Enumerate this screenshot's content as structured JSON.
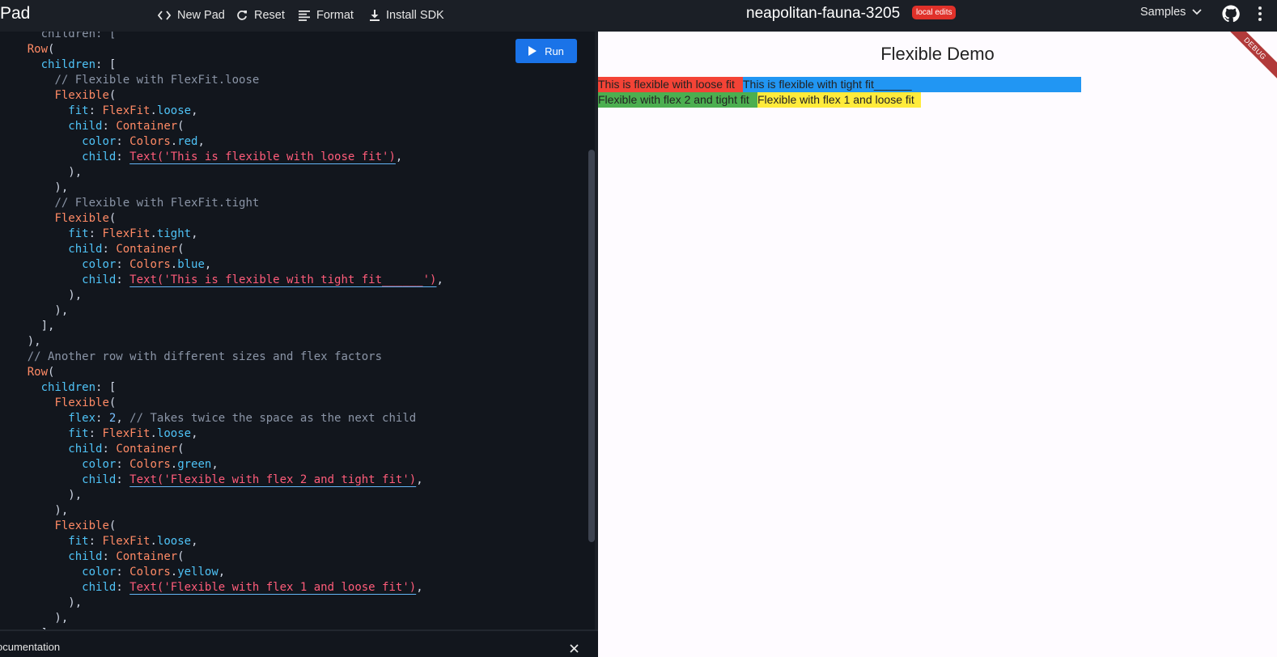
{
  "topbar": {
    "brand": "Pad",
    "new_pad": "New Pad",
    "reset": "Reset",
    "format": "Format",
    "install_sdk": "Install SDK",
    "pad_name": "neapolitan-fauna-3205",
    "badge": "local edits",
    "samples": "Samples"
  },
  "editor": {
    "run_label": "Run",
    "lines": [
      [
        [
          "c",
          "      children: ["
        ]
      ],
      [
        [
          "pu",
          "    "
        ],
        [
          "k",
          "Row"
        ],
        [
          "pu",
          "("
        ]
      ],
      [
        [
          "pu",
          "      "
        ],
        [
          "p",
          "children"
        ],
        [
          "pu",
          ": ["
        ]
      ],
      [
        [
          "pu",
          "        "
        ],
        [
          "c",
          "// Flexible with FlexFit.loose"
        ]
      ],
      [
        [
          "pu",
          "        "
        ],
        [
          "k",
          "Flexible"
        ],
        [
          "pu",
          "("
        ]
      ],
      [
        [
          "pu",
          "          "
        ],
        [
          "p",
          "fit"
        ],
        [
          "pu",
          ": "
        ],
        [
          "k",
          "FlexFit"
        ],
        [
          "pu",
          "."
        ],
        [
          "p",
          "loose"
        ],
        [
          "pu",
          ","
        ]
      ],
      [
        [
          "pu",
          "          "
        ],
        [
          "p",
          "child"
        ],
        [
          "pu",
          ": "
        ],
        [
          "k",
          "Container"
        ],
        [
          "pu",
          "("
        ]
      ],
      [
        [
          "pu",
          "            "
        ],
        [
          "p",
          "color"
        ],
        [
          "pu",
          ": "
        ],
        [
          "k",
          "Colors"
        ],
        [
          "pu",
          "."
        ],
        [
          "p",
          "red"
        ],
        [
          "pu",
          ","
        ]
      ],
      [
        [
          "pu",
          "            "
        ],
        [
          "p",
          "child"
        ],
        [
          "pu",
          ": "
        ],
        [
          "s",
          "Text('This is flexible with loose fit')"
        ],
        [
          "pu",
          ","
        ]
      ],
      [
        [
          "pu",
          "          ),"
        ]
      ],
      [
        [
          "pu",
          "        ),"
        ]
      ],
      [
        [
          "pu",
          "        "
        ],
        [
          "c",
          "// Flexible with FlexFit.tight"
        ]
      ],
      [
        [
          "pu",
          "        "
        ],
        [
          "k",
          "Flexible"
        ],
        [
          "pu",
          "("
        ]
      ],
      [
        [
          "pu",
          "          "
        ],
        [
          "p",
          "fit"
        ],
        [
          "pu",
          ": "
        ],
        [
          "k",
          "FlexFit"
        ],
        [
          "pu",
          "."
        ],
        [
          "p",
          "tight"
        ],
        [
          "pu",
          ","
        ]
      ],
      [
        [
          "pu",
          "          "
        ],
        [
          "p",
          "child"
        ],
        [
          "pu",
          ": "
        ],
        [
          "k",
          "Container"
        ],
        [
          "pu",
          "("
        ]
      ],
      [
        [
          "pu",
          "            "
        ],
        [
          "p",
          "color"
        ],
        [
          "pu",
          ": "
        ],
        [
          "k",
          "Colors"
        ],
        [
          "pu",
          "."
        ],
        [
          "p",
          "blue"
        ],
        [
          "pu",
          ","
        ]
      ],
      [
        [
          "pu",
          "            "
        ],
        [
          "p",
          "child"
        ],
        [
          "pu",
          ": "
        ],
        [
          "s",
          "Text('This is flexible with tight fit______')"
        ],
        [
          "pu",
          ","
        ]
      ],
      [
        [
          "pu",
          "          ),"
        ]
      ],
      [
        [
          "pu",
          "        ),"
        ]
      ],
      [
        [
          "pu",
          "      ],"
        ]
      ],
      [
        [
          "pu",
          "    ),"
        ]
      ],
      [
        [
          "pu",
          "    "
        ],
        [
          "c",
          "// Another row with different sizes and flex factors"
        ]
      ],
      [
        [
          "pu",
          "    "
        ],
        [
          "k",
          "Row"
        ],
        [
          "pu",
          "("
        ]
      ],
      [
        [
          "pu",
          "      "
        ],
        [
          "p",
          "children"
        ],
        [
          "pu",
          ": ["
        ]
      ],
      [
        [
          "pu",
          "        "
        ],
        [
          "k",
          "Flexible"
        ],
        [
          "pu",
          "("
        ]
      ],
      [
        [
          "pu",
          "          "
        ],
        [
          "p",
          "flex"
        ],
        [
          "pu",
          ": "
        ],
        [
          "n",
          "2"
        ],
        [
          "pu",
          ", "
        ],
        [
          "c",
          "// Takes twice the space as the next child"
        ]
      ],
      [
        [
          "pu",
          "          "
        ],
        [
          "p",
          "fit"
        ],
        [
          "pu",
          ": "
        ],
        [
          "k",
          "FlexFit"
        ],
        [
          "pu",
          "."
        ],
        [
          "p",
          "loose"
        ],
        [
          "pu",
          ","
        ]
      ],
      [
        [
          "pu",
          "          "
        ],
        [
          "p",
          "child"
        ],
        [
          "pu",
          ": "
        ],
        [
          "k",
          "Container"
        ],
        [
          "pu",
          "("
        ]
      ],
      [
        [
          "pu",
          "            "
        ],
        [
          "p",
          "color"
        ],
        [
          "pu",
          ": "
        ],
        [
          "k",
          "Colors"
        ],
        [
          "pu",
          "."
        ],
        [
          "p",
          "green"
        ],
        [
          "pu",
          ","
        ]
      ],
      [
        [
          "pu",
          "            "
        ],
        [
          "p",
          "child"
        ],
        [
          "pu",
          ": "
        ],
        [
          "s",
          "Text('Flexible with flex 2 and tight fit')"
        ],
        [
          "pu",
          ","
        ]
      ],
      [
        [
          "pu",
          "          ),"
        ]
      ],
      [
        [
          "pu",
          "        ),"
        ]
      ],
      [
        [
          "pu",
          "        "
        ],
        [
          "k",
          "Flexible"
        ],
        [
          "pu",
          "("
        ]
      ],
      [
        [
          "pu",
          "          "
        ],
        [
          "p",
          "fit"
        ],
        [
          "pu",
          ": "
        ],
        [
          "k",
          "FlexFit"
        ],
        [
          "pu",
          "."
        ],
        [
          "p",
          "loose"
        ],
        [
          "pu",
          ","
        ]
      ],
      [
        [
          "pu",
          "          "
        ],
        [
          "p",
          "child"
        ],
        [
          "pu",
          ": "
        ],
        [
          "k",
          "Container"
        ],
        [
          "pu",
          "("
        ]
      ],
      [
        [
          "pu",
          "            "
        ],
        [
          "p",
          "color"
        ],
        [
          "pu",
          ": "
        ],
        [
          "k",
          "Colors"
        ],
        [
          "pu",
          "."
        ],
        [
          "p",
          "yellow"
        ],
        [
          "pu",
          ","
        ]
      ],
      [
        [
          "pu",
          "            "
        ],
        [
          "p",
          "child"
        ],
        [
          "pu",
          ": "
        ],
        [
          "s",
          "Text('Flexible with flex 1 and loose fit')"
        ],
        [
          "pu",
          ","
        ]
      ],
      [
        [
          "pu",
          "          ),"
        ]
      ],
      [
        [
          "pu",
          "        ),"
        ]
      ],
      [
        [
          "pu",
          "      ],"
        ]
      ]
    ]
  },
  "documentation": {
    "label": "ocumentation"
  },
  "preview": {
    "title": "Flexible Demo",
    "debug_banner": "DEBUG",
    "row1": [
      {
        "text": "This is flexible with loose fit",
        "color": "#f44336"
      },
      {
        "text": "This is flexible with tight fit______",
        "color": "#2196f3"
      }
    ],
    "row2": [
      {
        "text": "Flexible with flex 2 and tight fit",
        "color": "#4caf50"
      },
      {
        "text": "Flexible with flex 1 and loose fit",
        "color": "#ffeb3b"
      }
    ]
  },
  "colors": {
    "topbar_bg": "#1b1f26",
    "editor_bg": "#12161d",
    "run_button": "#1a73e8",
    "badge": "#e0312a"
  }
}
